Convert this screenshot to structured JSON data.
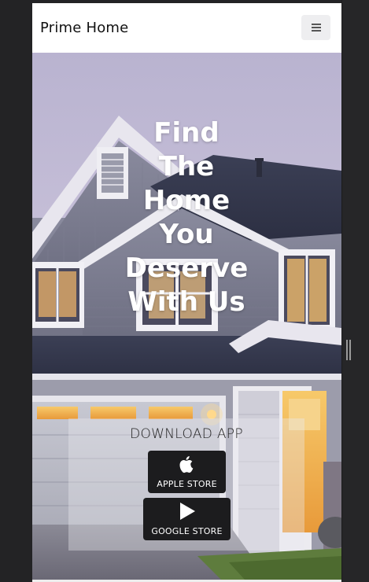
{
  "navbar": {
    "brand": "Prime Home",
    "menu_icon": "hamburger-icon"
  },
  "hero": {
    "headline_lines": [
      "Find",
      "The",
      "Home",
      "You",
      "Deserve",
      "With Us"
    ]
  },
  "download": {
    "title": "DOWNLOAD APP",
    "apple": {
      "label": "APPLE STORE",
      "icon": "apple-icon"
    },
    "google": {
      "label": "GOOGLE STORE",
      "icon": "play-icon"
    }
  },
  "colors": {
    "navbar_bg": "#ffffff",
    "button_bg": "#1c1c1e",
    "headline": "#ffffff"
  }
}
